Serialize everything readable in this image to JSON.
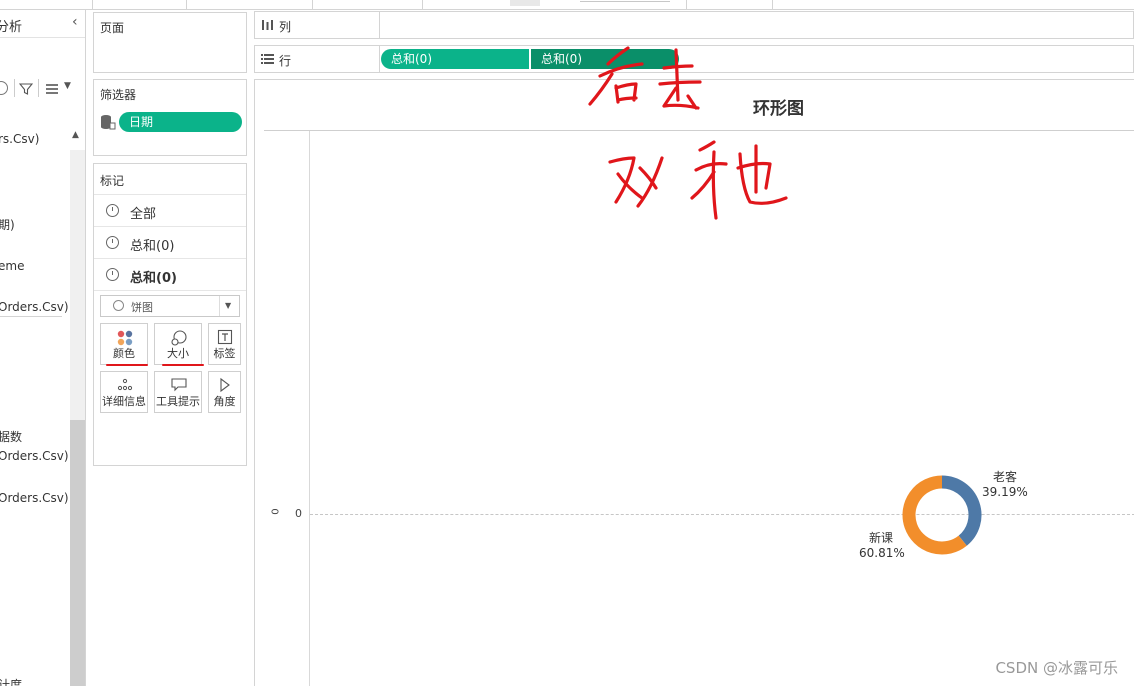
{
  "left_pane": {
    "title": "分析",
    "items": [
      "rs.Csv)",
      "期)",
      "eme",
      "Orders.Csv)",
      "据数",
      "Orders.Csv)",
      "Orders.Csv)",
      "计度"
    ]
  },
  "pages_card": {
    "title": "页面"
  },
  "filters_card": {
    "title": "筛选器",
    "pill": "日期"
  },
  "marks_card": {
    "title": "标记",
    "rows": [
      {
        "label": "全部",
        "bold": false
      },
      {
        "label": "总和(0)",
        "bold": false
      },
      {
        "label": "总和(0)",
        "bold": true
      }
    ],
    "mark_type": "饼图",
    "buttons": [
      "颜色",
      "大小",
      "标签",
      "详细信息",
      "工具提示",
      "角度"
    ]
  },
  "columns_shelf": {
    "label": "列"
  },
  "rows_shelf": {
    "label": "行",
    "pills": [
      "总和(0)",
      "总和(0)"
    ]
  },
  "view": {
    "title": "环形图",
    "axis_zero_left": "0",
    "axis_zero_right": "0",
    "slices": [
      {
        "name": "老客",
        "percent": "39.19%",
        "fraction": 0.3919,
        "color": "#4e79a7"
      },
      {
        "name": "新课",
        "percent": "60.81%",
        "fraction": 0.6081,
        "color": "#f28e2b"
      }
    ]
  },
  "annotations": {
    "line1": "右击",
    "line2": "双轴"
  },
  "watermark": "CSDN @冰露可乐",
  "colors": {
    "pill_green": "#0bb38a",
    "pill_dark_green": "#0a8f69",
    "annotation_red": "#e0161b"
  }
}
